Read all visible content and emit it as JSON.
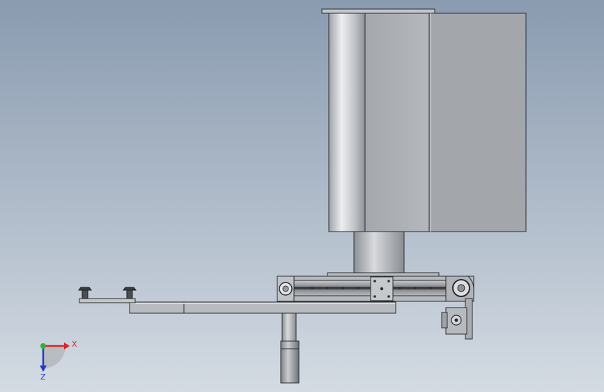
{
  "colors": {
    "background_top": "#8a9bb0",
    "background_bottom": "#d4dbe3",
    "part_light": "#c9ccd0",
    "part_mid": "#a9adb2",
    "part_dark": "#6c7075",
    "outline": "#2a2c2f",
    "axis_x": "#d8262a",
    "axis_y": "#2bb43a",
    "axis_z": "#2438c8"
  },
  "axes": {
    "x_label": "X",
    "z_label": "Z"
  }
}
